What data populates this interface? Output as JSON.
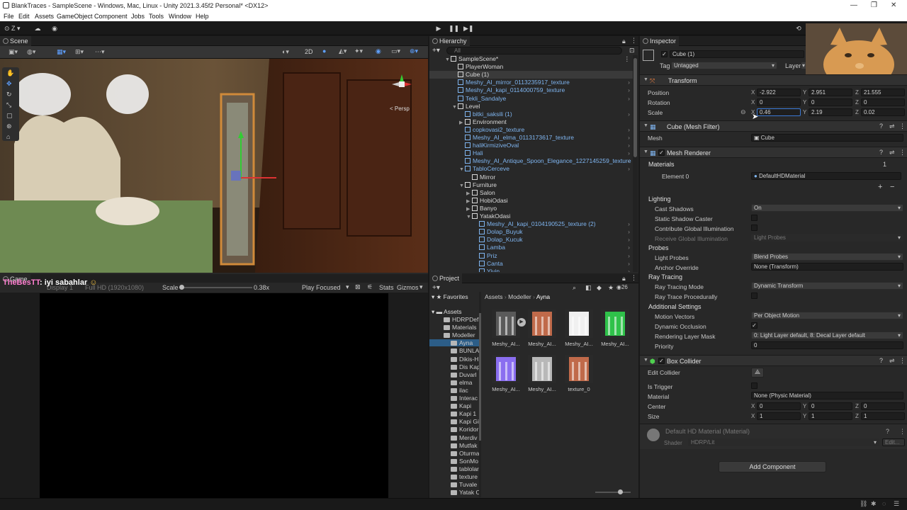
{
  "window": {
    "title": "BlankTraces - SampleScene - Windows, Mac, Linux - Unity 2021.3.45f2 Personal* <DX12>",
    "minimize": "—",
    "restore": "❐",
    "close": "✕"
  },
  "menu": [
    "File",
    "Edit",
    "Assets",
    "GameObject",
    "Component",
    "Jobs",
    "Tools",
    "Window",
    "Help"
  ],
  "toolbar": {
    "account": "Z",
    "play": "▶",
    "pause": "❚❚",
    "step": "▶❚"
  },
  "scene": {
    "tab": "Scene",
    "mode_2d": "2D",
    "persp": "< Persp"
  },
  "game": {
    "tab": "Game",
    "display": "Display 1",
    "resolution": "Full HD (1920x1080)",
    "scale_label": "Scale",
    "scale_value": "0.38x",
    "play_mode": "Play Focused",
    "stats": "Stats",
    "gizmos": "Gizmos",
    "chat_user": "TheBesTT",
    "chat_msg": ": iyi sabahlar"
  },
  "hierarchy": {
    "tab": "Hierarchy",
    "search_placeholder": "All",
    "rows": [
      {
        "label": "SampleScene*",
        "color": "white",
        "indent": 0,
        "arrow": "▼"
      },
      {
        "label": "PlayerWoman",
        "color": "white",
        "indent": 1,
        "arrow": ""
      },
      {
        "label": "Cube (1)",
        "color": "white",
        "indent": 1,
        "arrow": "",
        "selected": true
      },
      {
        "label": "Meshy_AI_mirror_0113235917_texture",
        "color": "blue",
        "indent": 1,
        "arrow": ""
      },
      {
        "label": "Meshy_AI_kapi_0114000759_texture",
        "color": "blue",
        "indent": 1,
        "arrow": ""
      },
      {
        "label": "Tekli_Sandalye",
        "color": "blue",
        "indent": 1,
        "arrow": ""
      },
      {
        "label": "Level",
        "color": "white",
        "indent": 1,
        "arrow": "▼"
      },
      {
        "label": "bitki_saksili (1)",
        "color": "blue",
        "indent": 2,
        "arrow": ""
      },
      {
        "label": "Environment",
        "color": "white",
        "indent": 2,
        "arrow": "▶"
      },
      {
        "label": "copkovasi2_texture",
        "color": "blue",
        "indent": 2,
        "arrow": ""
      },
      {
        "label": "Meshy_AI_elma_0113173617_texture",
        "color": "blue",
        "indent": 2,
        "arrow": ""
      },
      {
        "label": "haliKirmiziveOval",
        "color": "blue",
        "indent": 2,
        "arrow": ""
      },
      {
        "label": "Hali",
        "color": "blue",
        "indent": 2,
        "arrow": ""
      },
      {
        "label": "Meshy_AI_Antique_Spoon_Elegance_1227145259_texture (2)",
        "color": "blue",
        "indent": 2,
        "arrow": ""
      },
      {
        "label": "TabloCerceve",
        "color": "blue",
        "indent": 2,
        "arrow": "▼"
      },
      {
        "label": "Mirror",
        "color": "white",
        "indent": 3,
        "arrow": ""
      },
      {
        "label": "Furniture",
        "color": "white",
        "indent": 2,
        "arrow": "▼"
      },
      {
        "label": "Salon",
        "color": "white",
        "indent": 3,
        "arrow": "▶"
      },
      {
        "label": "HobiOdasi",
        "color": "white",
        "indent": 3,
        "arrow": "▶"
      },
      {
        "label": "Banyo",
        "color": "white",
        "indent": 3,
        "arrow": "▶"
      },
      {
        "label": "YatakOdasi",
        "color": "white",
        "indent": 3,
        "arrow": "▼"
      },
      {
        "label": "Meshy_AI_kapi_0104190525_texture (2)",
        "color": "blue",
        "indent": 4,
        "arrow": ""
      },
      {
        "label": "Dolap_Buyuk",
        "color": "blue",
        "indent": 4,
        "arrow": ""
      },
      {
        "label": "Dolap_Kucuk",
        "color": "blue",
        "indent": 4,
        "arrow": ""
      },
      {
        "label": "Lamba",
        "color": "blue",
        "indent": 4,
        "arrow": ""
      },
      {
        "label": "Priz",
        "color": "blue",
        "indent": 4,
        "arrow": ""
      },
      {
        "label": "Canta",
        "color": "blue",
        "indent": 4,
        "arrow": ""
      },
      {
        "label": "Yiyin",
        "color": "blue",
        "indent": 4,
        "arrow": ""
      }
    ]
  },
  "project": {
    "tab": "Project",
    "favorites": "Favorites",
    "assets_root": "Assets",
    "count": "26",
    "breadcrumb": [
      "Assets",
      "Modeller",
      "Ayna"
    ],
    "folders": [
      {
        "label": "HDRPDef",
        "indent": 1
      },
      {
        "label": "Materials",
        "indent": 1
      },
      {
        "label": "Modeller",
        "indent": 1
      },
      {
        "label": "Ayna",
        "indent": 2,
        "selected": true
      },
      {
        "label": "BUNLA",
        "indent": 2
      },
      {
        "label": "Dikis-H",
        "indent": 2
      },
      {
        "label": "Dis Kap",
        "indent": 2
      },
      {
        "label": "Duvarl",
        "indent": 2
      },
      {
        "label": "elma",
        "indent": 2
      },
      {
        "label": "ilac",
        "indent": 2
      },
      {
        "label": "Interac",
        "indent": 2
      },
      {
        "label": "Kapi",
        "indent": 2
      },
      {
        "label": "Kapi 1",
        "indent": 2
      },
      {
        "label": "Kapi Gi",
        "indent": 2
      },
      {
        "label": "Koridor",
        "indent": 2
      },
      {
        "label": "Merdiv",
        "indent": 2
      },
      {
        "label": "Mutfak",
        "indent": 2
      },
      {
        "label": "Oturma",
        "indent": 2
      },
      {
        "label": "SonMo",
        "indent": 2
      },
      {
        "label": "tablolar",
        "indent": 2
      },
      {
        "label": "texture",
        "indent": 2
      },
      {
        "label": "Tuvale",
        "indent": 2
      },
      {
        "label": "Yatak O",
        "indent": 2
      }
    ],
    "items": [
      {
        "label": "Meshy_AI...",
        "color": "#5a5a5a"
      },
      {
        "label": "Meshy_AI...",
        "color": "#c06a4a"
      },
      {
        "label": "Meshy_AI...",
        "color": "#f0f0f0"
      },
      {
        "label": "Meshy_AI...",
        "color": "#2fc24a"
      },
      {
        "label": "Meshy_AI...",
        "color": "#8a6ef0"
      },
      {
        "label": "Meshy_AI...",
        "color": "#b8b8b8"
      },
      {
        "label": "texture_0",
        "color": "#c06a4a"
      }
    ]
  },
  "inspector": {
    "tab": "Inspector",
    "object_name": "Cube (1)",
    "tag_label": "Tag",
    "tag_value": "Untagged",
    "layer_label": "Layer",
    "transform": {
      "title": "Transform",
      "position": {
        "label": "Position",
        "x": "-2.922",
        "y": "2.951",
        "z": "21.555"
      },
      "rotation": {
        "label": "Rotation",
        "x": "0",
        "y": "0",
        "z": "0"
      },
      "scale": {
        "label": "Scale",
        "x": "0.46",
        "y": "2.19",
        "z": "0.02"
      }
    },
    "mesh_filter": {
      "title": "Cube (Mesh Filter)",
      "mesh_label": "Mesh",
      "mesh_value": "Cube"
    },
    "mesh_renderer": {
      "title": "Mesh Renderer",
      "materials_label": "Materials",
      "materials_count": "1",
      "element0_label": "Element 0",
      "element0_value": "DefaultHDMaterial",
      "lighting": "Lighting",
      "cast_shadows_label": "Cast Shadows",
      "cast_shadows_value": "On",
      "static_shadow_label": "Static Shadow Caster",
      "contribute_gi_label": "Contribute Global Illumination",
      "receive_gi_label": "Receive Global Illumination",
      "receive_gi_value": "Light Probes",
      "probes": "Probes",
      "light_probes_label": "Light Probes",
      "light_probes_value": "Blend Probes",
      "anchor_label": "Anchor Override",
      "anchor_value": "None (Transform)",
      "ray_tracing": "Ray Tracing",
      "rt_mode_label": "Ray Tracing Mode",
      "rt_mode_value": "Dynamic Transform",
      "rt_proc_label": "Ray Trace Procedurally",
      "additional": "Additional Settings",
      "motion_label": "Motion Vectors",
      "motion_value": "Per Object Motion",
      "dyn_occ_label": "Dynamic Occlusion",
      "rlm_label": "Rendering Layer Mask",
      "rlm_value": "0: Light Layer default, 8: Decal Layer default",
      "priority_label": "Priority",
      "priority_value": "0"
    },
    "box_collider": {
      "title": "Box Collider",
      "edit_label": "Edit Collider",
      "trigger_label": "Is Trigger",
      "material_label": "Material",
      "material_value": "None (Physic Material)",
      "center_label": "Center",
      "center": {
        "x": "0",
        "y": "0",
        "z": "0"
      },
      "size_label": "Size",
      "size": {
        "x": "1",
        "y": "1",
        "z": "1"
      }
    },
    "material": {
      "title": "Default HD Material (Material)",
      "shader_label": "Shader",
      "shader_value": "HDRP/Lit",
      "edit": "Edit..."
    },
    "add_component": "Add Component"
  },
  "colors": {
    "panel": "#282828",
    "accent": "#3a79d6",
    "prefab_blue": "#7fb5f0",
    "chat_name": "#ff7fd0"
  }
}
